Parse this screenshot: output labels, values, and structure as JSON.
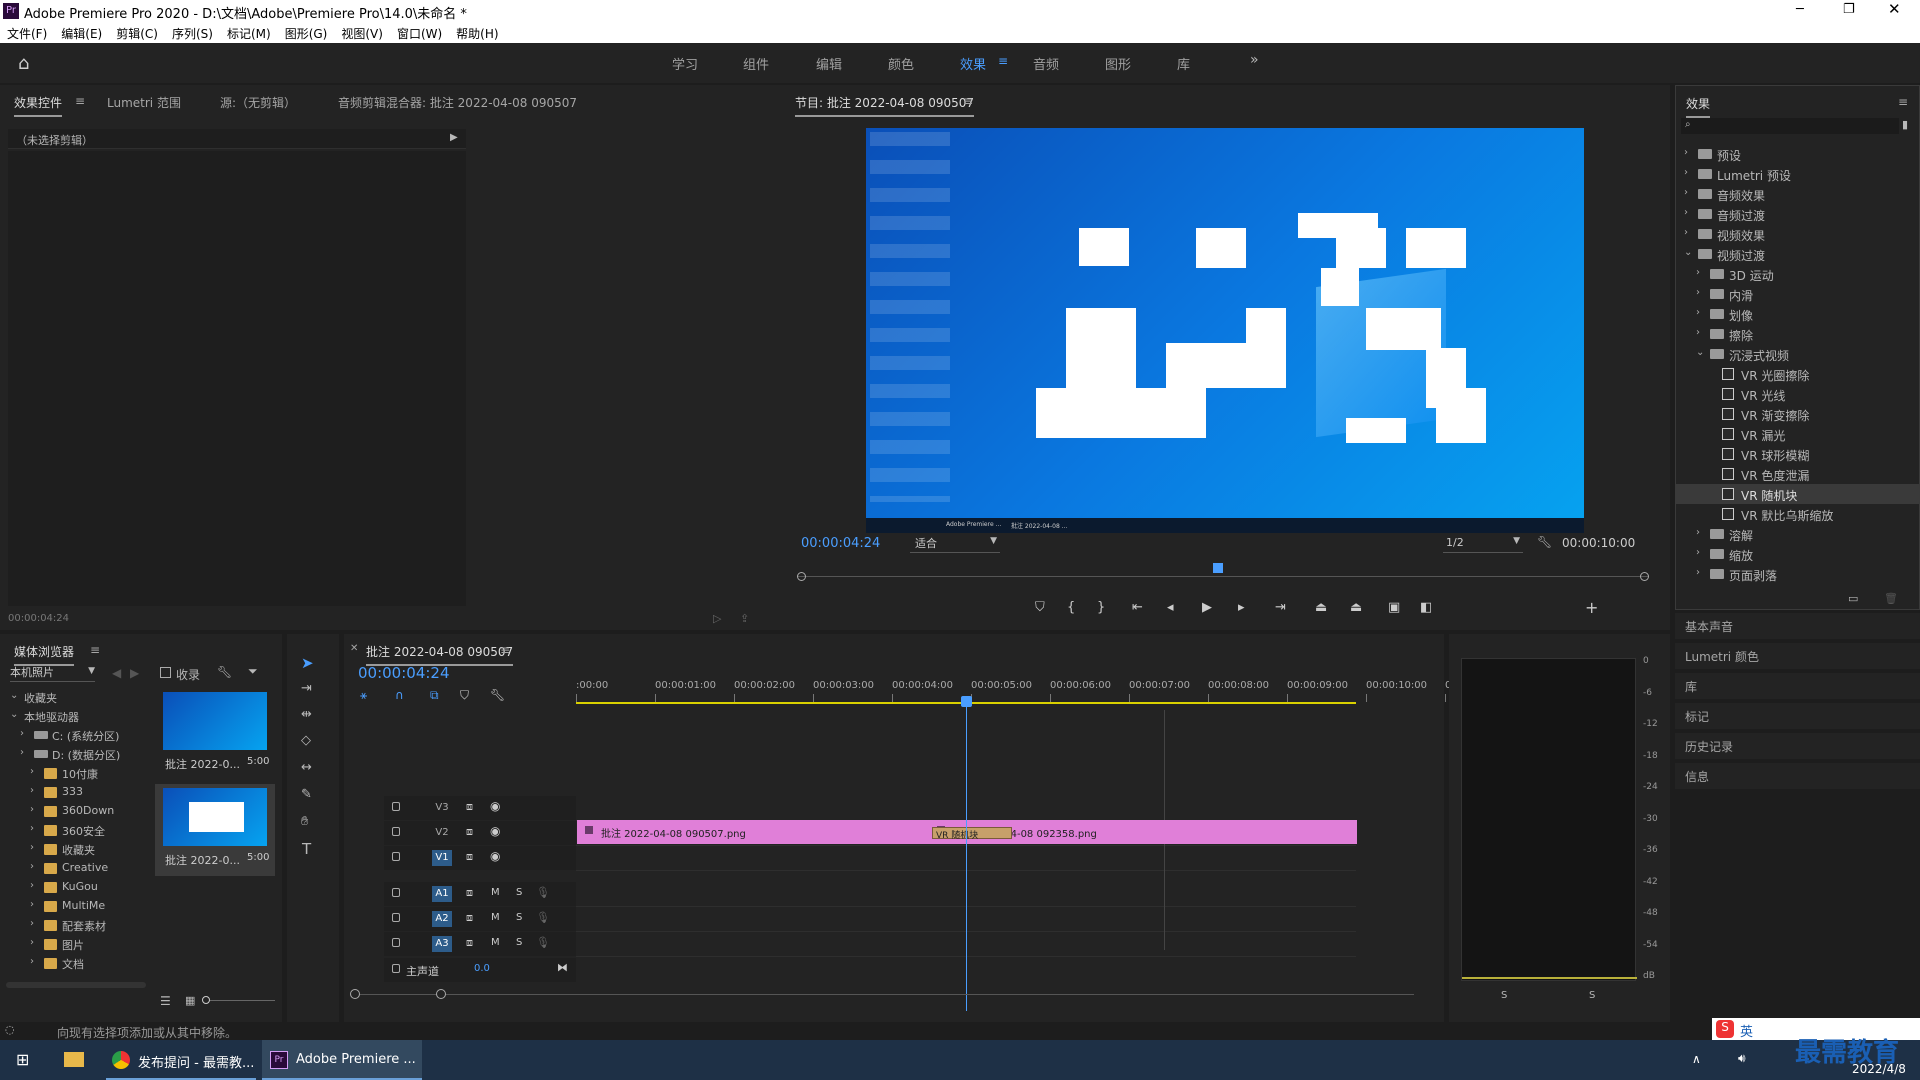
{
  "window": {
    "app_icon": "Pr",
    "title": "Adobe Premiere Pro 2020 - D:\\文档\\Adobe\\Premiere Pro\\14.0\\未命名 *"
  },
  "menu": [
    "文件(F)",
    "编辑(E)",
    "剪辑(C)",
    "序列(S)",
    "标记(M)",
    "图形(G)",
    "视图(V)",
    "窗口(W)",
    "帮助(H)"
  ],
  "workspaces": [
    "学习",
    "组件",
    "编辑",
    "颜色",
    "效果",
    "音频",
    "图形",
    "库"
  ],
  "active_workspace": "效果",
  "source_panel": {
    "tabs": [
      "效果控件",
      "Lumetri 范围",
      "源:（无剪辑）",
      "音频剪辑混合器: 批注 2022-04-08 090507"
    ],
    "no_clip": "（未选择剪辑）",
    "timecode": "00:00:04:24"
  },
  "program": {
    "title": "节目: 批注 2022-04-08 090507",
    "timecode": "00:00:04:24",
    "fit": "适合",
    "quality": "1/2",
    "duration": "00:00:10:00"
  },
  "preview": {
    "taskbar_items": [
      "Adobe Premiere ...",
      "批注 2022-04-08 ..."
    ]
  },
  "media_browser": {
    "title": "媒体浏览器",
    "location": "本机照片",
    "collect": "收录",
    "tree": [
      {
        "label": "收藏夹",
        "level": 0
      },
      {
        "label": "本地驱动器",
        "level": 0
      },
      {
        "label": "C: (系统分区)",
        "level": 1
      },
      {
        "label": "D: (数据分区)",
        "level": 1
      },
      {
        "label": "10付康",
        "level": 2
      },
      {
        "label": "333",
        "level": 2
      },
      {
        "label": "360Down",
        "level": 2
      },
      {
        "label": "360安全",
        "level": 2
      },
      {
        "label": "收藏夹",
        "level": 2
      },
      {
        "label": "Creative",
        "level": 2
      },
      {
        "label": "KuGou",
        "level": 2
      },
      {
        "label": "MultiMe",
        "level": 2
      },
      {
        "label": "配套素材",
        "level": 2
      },
      {
        "label": "图片",
        "level": 2
      },
      {
        "label": "文档",
        "level": 2
      }
    ],
    "thumbs": [
      {
        "name": "批注 2022-0...",
        "dur": "5:00"
      },
      {
        "name": "批注 2022-0...",
        "dur": "5:00"
      }
    ]
  },
  "timeline": {
    "tab": "批注 2022-04-08 090507",
    "timecode": "00:00:04:24",
    "ruler": [
      ":00:00",
      "00:00:01:00",
      "00:00:02:00",
      "00:00:03:00",
      "00:00:04:00",
      "00:00:05:00",
      "00:00:06:00",
      "00:00:07:00",
      "00:00:08:00",
      "00:00:09:00",
      "00:00:10:00",
      "0"
    ],
    "video_tracks": [
      "V3",
      "V2",
      "V1"
    ],
    "audio_tracks": [
      "A1",
      "A2",
      "A3"
    ],
    "master": "主声道",
    "master_val": "0.0",
    "mute": "M",
    "solo": "S",
    "clip1": "批注 2022-04-08 090507.png",
    "clip2": "批注 2022-04-08 092358.png",
    "transition": "VR 随机块"
  },
  "meters": {
    "labels": [
      "0",
      "-6",
      "-12",
      "-18",
      "-24",
      "-30",
      "-36",
      "-42",
      "-48",
      "-54",
      "dB"
    ],
    "solo_l": "S",
    "solo_r": "S"
  },
  "effects": {
    "title": "效果",
    "items": [
      {
        "label": "预设",
        "level": 0,
        "type": "folder",
        "open": false
      },
      {
        "label": "Lumetri 预设",
        "level": 0,
        "type": "folder",
        "open": false
      },
      {
        "label": "音频效果",
        "level": 0,
        "type": "folder",
        "open": false
      },
      {
        "label": "音频过渡",
        "level": 0,
        "type": "folder",
        "open": false
      },
      {
        "label": "视频效果",
        "level": 0,
        "type": "folder",
        "open": false
      },
      {
        "label": "视频过渡",
        "level": 0,
        "type": "folder",
        "open": true
      },
      {
        "label": "3D 运动",
        "level": 1,
        "type": "folder",
        "open": false
      },
      {
        "label": "内滑",
        "level": 1,
        "type": "folder",
        "open": false
      },
      {
        "label": "划像",
        "level": 1,
        "type": "folder",
        "open": false
      },
      {
        "label": "擦除",
        "level": 1,
        "type": "folder",
        "open": false
      },
      {
        "label": "沉浸式视频",
        "level": 1,
        "type": "folder",
        "open": true
      },
      {
        "label": "VR 光圈擦除",
        "level": 2,
        "type": "preset"
      },
      {
        "label": "VR 光线",
        "level": 2,
        "type": "preset"
      },
      {
        "label": "VR 渐变擦除",
        "level": 2,
        "type": "preset"
      },
      {
        "label": "VR 漏光",
        "level": 2,
        "type": "preset"
      },
      {
        "label": "VR 球形模糊",
        "level": 2,
        "type": "preset"
      },
      {
        "label": "VR 色度泄漏",
        "level": 2,
        "type": "preset"
      },
      {
        "label": "VR 随机块",
        "level": 2,
        "type": "preset",
        "selected": true
      },
      {
        "label": "VR 默比乌斯缩放",
        "level": 2,
        "type": "preset"
      },
      {
        "label": "溶解",
        "level": 1,
        "type": "folder",
        "open": false
      },
      {
        "label": "缩放",
        "level": 1,
        "type": "folder",
        "open": false
      },
      {
        "label": "页面剥落",
        "level": 1,
        "type": "folder",
        "open": false
      }
    ]
  },
  "side_panels": [
    "基本声音",
    "Lumetri 颜色",
    "库",
    "标记",
    "历史记录",
    "信息"
  ],
  "status": "向现有选择项添加或从其中移除。",
  "taskbar": {
    "apps": [
      "发布提问 - 最需教...",
      "Adobe Premiere ..."
    ],
    "watermark": "最需教育",
    "date": "2022/4/8",
    "ime": "英"
  },
  "colors": {
    "accent": "#4a9eff",
    "clip": "#e07fd8",
    "playhead": "#4a9eff"
  }
}
